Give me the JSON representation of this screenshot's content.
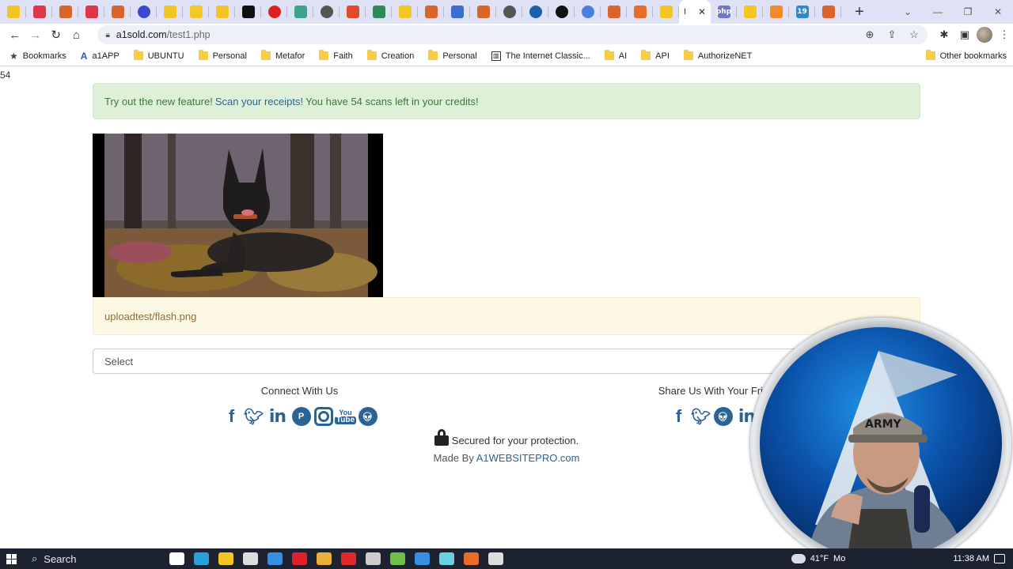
{
  "browser": {
    "tabs": [
      {
        "icon": "smiley-icon",
        "color": "#f3c623"
      },
      {
        "icon": "pocket-icon",
        "color": "#e0364a"
      },
      {
        "icon": "mountain-icon",
        "color": "#d9642c"
      },
      {
        "icon": "pocket-icon",
        "color": "#e0364a"
      },
      {
        "icon": "mountain-icon",
        "color": "#d9642c"
      },
      {
        "icon": "dots-icon",
        "color": "#3a4bd1"
      },
      {
        "icon": "smiley-icon",
        "color": "#f3c623"
      },
      {
        "icon": "smiley-icon",
        "color": "#f3c623"
      },
      {
        "icon": "smiley-icon",
        "color": "#f3c623"
      },
      {
        "icon": "flag-icon",
        "color": "#111111"
      },
      {
        "icon": "youtube-icon",
        "color": "#e02020"
      },
      {
        "icon": "openai-icon",
        "color": "#3aa58c"
      },
      {
        "icon": "github-icon",
        "color": "#555555"
      },
      {
        "icon": "w3-icon",
        "color": "#e04a2a"
      },
      {
        "icon": "code-icon",
        "color": "#2e8b57"
      },
      {
        "icon": "smiley-icon",
        "color": "#f3c623"
      },
      {
        "icon": "pencil-icon",
        "color": "#d9642c"
      },
      {
        "icon": "x-icon",
        "color": "#3a6fd1"
      },
      {
        "icon": "pencil-icon",
        "color": "#d9642c"
      },
      {
        "icon": "profile-icon",
        "color": "#555555"
      },
      {
        "icon": "wordpress-icon",
        "color": "#1d5fa8"
      },
      {
        "icon": "github-icon",
        "color": "#111111"
      },
      {
        "icon": "google-icon",
        "color": "#4a7fe0"
      },
      {
        "icon": "pencil-icon",
        "color": "#d9642c"
      },
      {
        "icon": "xampp-icon",
        "color": "#e86b2a"
      },
      {
        "icon": "smiley-icon",
        "color": "#f3c623"
      }
    ],
    "active_tab_label": "I",
    "tabs_after": [
      {
        "icon": "php-icon",
        "color": "#6e77c8",
        "text": "php"
      },
      {
        "icon": "smiley-icon",
        "color": "#f3c623"
      },
      {
        "icon": "cloud-icon",
        "color": "#f28a2a"
      },
      {
        "icon": "calendar-icon",
        "color": "#2a8ad1",
        "text": "19"
      },
      {
        "icon": "pencil-icon",
        "color": "#d9642c"
      }
    ],
    "url_host": "a1sold.com",
    "url_path": "/test1.php",
    "bookmarks": [
      {
        "label": "Bookmarks",
        "type": "star"
      },
      {
        "label": "a1APP",
        "type": "a1"
      },
      {
        "label": "UBUNTU",
        "type": "folder"
      },
      {
        "label": "Personal",
        "type": "folder"
      },
      {
        "label": "Metafor",
        "type": "folder"
      },
      {
        "label": "Faith",
        "type": "folder"
      },
      {
        "label": "Creation",
        "type": "folder"
      },
      {
        "label": "Personal",
        "type": "folder"
      },
      {
        "label": "The Internet Classic...",
        "type": "archive"
      },
      {
        "label": "AI",
        "type": "folder"
      },
      {
        "label": "API",
        "type": "folder"
      },
      {
        "label": "AuthorizeNET",
        "type": "folder"
      }
    ],
    "other_bookmarks": "Other bookmarks"
  },
  "page": {
    "counter": "54",
    "alert": {
      "prefix": "Try out the new feature!",
      "link": "Scan your receipts!",
      "suffix": "You have 54 scans left in your credits!"
    },
    "image_path": "uploadtest/flash.png",
    "select_value": "Select",
    "connect_title": "Connect With Us",
    "share_title": "Share Us With Your Frie",
    "connect_icons": [
      "facebook-icon",
      "twitter-icon",
      "linkedin-icon",
      "pinterest-icon",
      "instagram-icon",
      "youtube-icon",
      "reddit-icon"
    ],
    "share_icons": [
      "facebook-icon",
      "twitter-icon",
      "reddit-icon",
      "linkedin-icon"
    ],
    "secured_text": "Secured for your protection.",
    "made_by_prefix": "Made By",
    "made_by_link": "A1WEBSITEPRO.com",
    "youtube_top": "You",
    "youtube_bottom": "Tube"
  },
  "taskbar": {
    "search_label": "Search",
    "weather": "41°F",
    "weather_suffix": "Mo",
    "time": "11:38 AM",
    "apps": [
      {
        "icon": "taskview-icon",
        "color": "#ffffff"
      },
      {
        "icon": "edge-icon",
        "color": "#2a9fd8"
      },
      {
        "icon": "explorer-icon",
        "color": "#f3c623"
      },
      {
        "icon": "store-icon",
        "color": "#dddddd"
      },
      {
        "icon": "mail-icon",
        "color": "#3a8de0"
      },
      {
        "icon": "opera-icon",
        "color": "#e0202a"
      },
      {
        "icon": "chrome-icon",
        "color": "#e8b03a"
      },
      {
        "icon": "app-icon",
        "color": "#e02a2a"
      },
      {
        "icon": "network-icon",
        "color": "#cccccc"
      },
      {
        "icon": "notepad-icon",
        "color": "#6cc04a"
      },
      {
        "icon": "photos-icon",
        "color": "#3a8de0"
      },
      {
        "icon": "editor-icon",
        "color": "#6ad0e0"
      },
      {
        "icon": "xampp-icon",
        "color": "#e86b2a"
      },
      {
        "icon": "obs-icon",
        "color": "#dddddd"
      }
    ]
  },
  "webcam": {
    "cap_text": "ARMY"
  }
}
